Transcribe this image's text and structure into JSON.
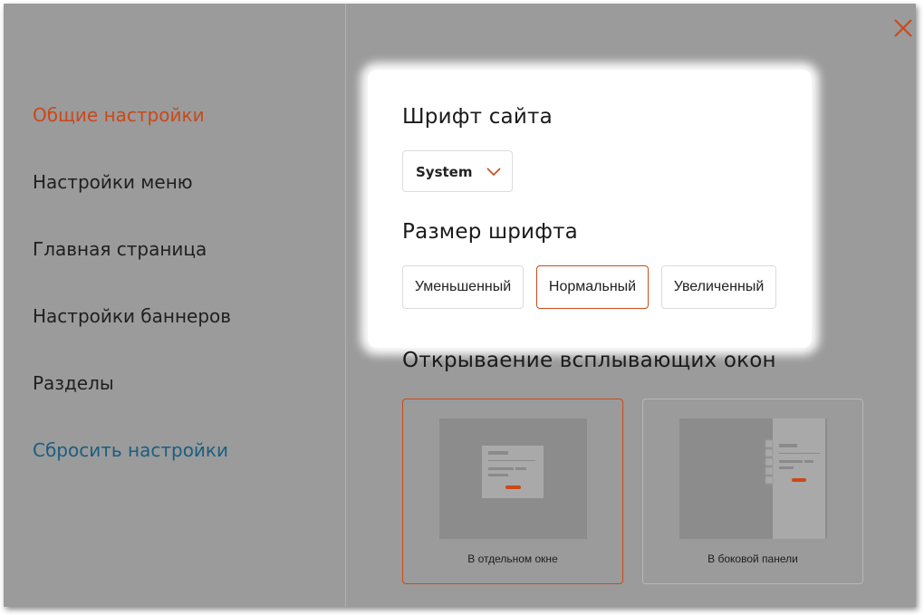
{
  "sidebar": {
    "items": [
      {
        "label": "Общие настройки",
        "color": "#c9481a"
      },
      {
        "label": "Настройки меню",
        "color": "#1f1f1f"
      },
      {
        "label": "Главная страница",
        "color": "#1f1f1f"
      },
      {
        "label": "Настройки баннеров",
        "color": "#1f1f1f"
      },
      {
        "label": "Разделы",
        "color": "#1f1f1f"
      }
    ],
    "reset_label": "Сбросить настройки",
    "reset_color": "#1a5e80"
  },
  "close_icon": "close-icon",
  "font_section": {
    "title": "Шрифт сайта",
    "selected": "System"
  },
  "size_section": {
    "title": "Размер шрифта",
    "options": [
      "Уменьшенный",
      "Нормальный",
      "Увеличенный"
    ],
    "selected": "Нормальный"
  },
  "popup_section": {
    "title": "Открываение всплывающих окон",
    "options": [
      "В отдельном окне",
      "В боковой панели"
    ],
    "selected": "В отдельном окне"
  },
  "colors": {
    "accent": "#c94a1a",
    "overlay": "#9b9b9b"
  }
}
